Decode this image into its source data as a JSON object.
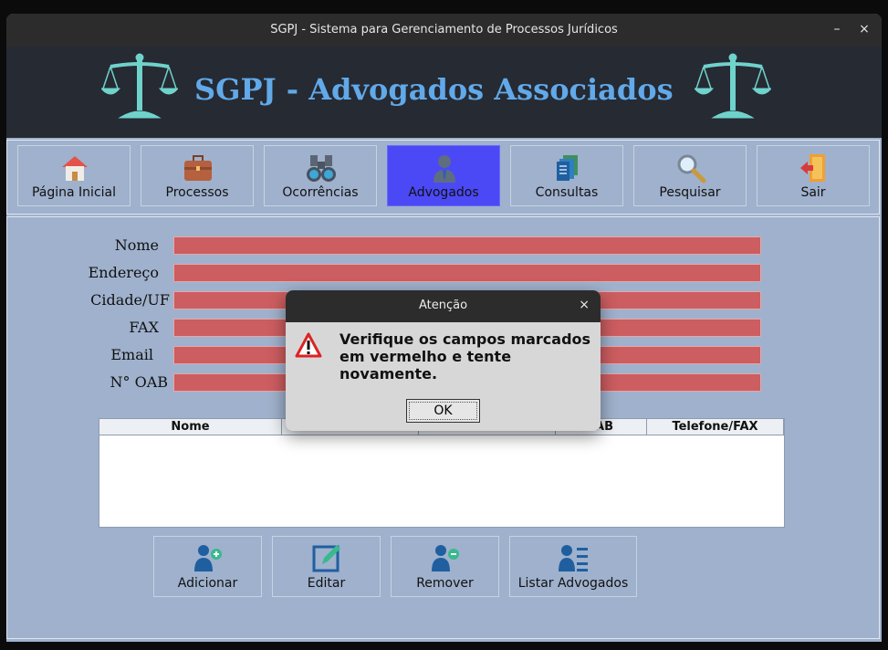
{
  "window": {
    "title": "SGPJ - Sistema para Gerenciamento de Processos Jurídicos",
    "minimize": "–",
    "close": "×"
  },
  "banner": {
    "headline": "SGPJ - Advogados Associados"
  },
  "nav": {
    "items": [
      {
        "label": "Página Inicial",
        "icon": "home-icon"
      },
      {
        "label": "Processos",
        "icon": "briefcase-icon"
      },
      {
        "label": "Ocorrências",
        "icon": "binoculars-icon"
      },
      {
        "label": "Advogados",
        "icon": "lawyer-icon",
        "active": true
      },
      {
        "label": "Consultas",
        "icon": "documents-icon"
      },
      {
        "label": "Pesquisar",
        "icon": "magnifier-icon"
      },
      {
        "label": "Sair",
        "icon": "exit-door-icon"
      }
    ]
  },
  "form": {
    "fields": [
      {
        "label": "Nome",
        "value": ""
      },
      {
        "label": "Endereço",
        "value": ""
      },
      {
        "label": "Cidade/UF",
        "value": ""
      },
      {
        "label": "FAX",
        "value": ""
      },
      {
        "label": "Email",
        "value": ""
      },
      {
        "label": "N° OAB",
        "value": ""
      }
    ],
    "error_color": "#cc5d60"
  },
  "table": {
    "columns": [
      "Nome",
      "",
      "",
      "AB",
      "Telefone/FAX"
    ],
    "rows": []
  },
  "actions": [
    {
      "label": "Adicionar",
      "icon": "add-user-icon"
    },
    {
      "label": "Editar",
      "icon": "edit-icon"
    },
    {
      "label": "Remover",
      "icon": "remove-user-icon"
    },
    {
      "label": "Listar Advogados",
      "icon": "list-users-icon"
    }
  ],
  "dialog": {
    "title": "Atenção",
    "close": "×",
    "message": "Verifique os campos marcados em vermelho e tente novamente.",
    "ok_label": "OK",
    "icon": "warning-icon"
  }
}
